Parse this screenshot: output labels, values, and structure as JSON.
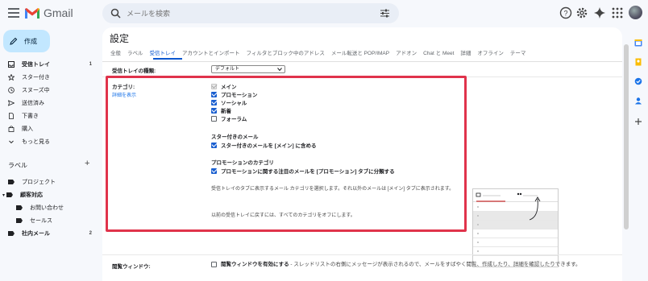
{
  "app": {
    "name": "Gmail",
    "search_placeholder": "メールを検索"
  },
  "colors": {
    "accent": "#0b57d0",
    "highlight_border": "#e0334b",
    "compose_bg": "#c2e7ff"
  },
  "sidebar": {
    "compose_label": "作成",
    "items": [
      {
        "label": "受信トレイ",
        "count": "1",
        "icon": "inbox-icon",
        "bold": true
      },
      {
        "label": "スター付き",
        "icon": "star-icon"
      },
      {
        "label": "スヌーズ中",
        "icon": "clock-icon"
      },
      {
        "label": "送信済み",
        "icon": "send-icon"
      },
      {
        "label": "下書き",
        "icon": "draft-icon"
      },
      {
        "label": "購入",
        "icon": "purchase-icon"
      },
      {
        "label": "もっと見る",
        "icon": "chevron-down-icon"
      }
    ],
    "labels_heading": "ラベル",
    "labels": [
      {
        "label": "プロジェクト"
      },
      {
        "label": "顧客対応",
        "bold": true
      },
      {
        "label": "お問い合わせ"
      },
      {
        "label": "セールス"
      },
      {
        "label": "社内メール",
        "count": "2",
        "bold": true
      }
    ]
  },
  "settings": {
    "title": "設定",
    "tabs": [
      "全般",
      "ラベル",
      "受信トレイ",
      "アカウントとインポート",
      "フィルタとブロック中のアドレス",
      "メール転送と POP/IMAP",
      "アドオン",
      "Chat と Meet",
      "詳細",
      "オフライン",
      "テーマ"
    ],
    "active_tab_index": 2,
    "inbox_type_label": "受信トレイの種類:",
    "inbox_type_value": "デフォルト",
    "categories_label": "カテゴリ:",
    "details_link": "詳細を表示",
    "categories": [
      {
        "label": "メイン",
        "checked": true,
        "disabled": true
      },
      {
        "label": "プロモーション",
        "checked": true
      },
      {
        "label": "ソーシャル",
        "checked": true
      },
      {
        "label": "新着",
        "checked": true
      },
      {
        "label": "フォーラム",
        "checked": false
      }
    ],
    "starred_heading": "スター付きのメール",
    "starred_option": "スター付きのメールを [メイン] に含める",
    "promo_heading": "プロモーションのカテゴリ",
    "promo_option": "プロモーションに関する注目のメールを [プロモーション] タブに分類する",
    "description_1": "受信トレイのタブに表示するメール カテゴリを選択します。それ以外のメールは [メイン] タブに表示されます。",
    "description_2": "以前の受信トレイに戻すには、すべてのカテゴリをオフにします。",
    "reading_pane_label": "閲覧ウィンドウ:",
    "reading_pane_option": "閲覧ウィンドウを有効にする",
    "reading_pane_desc": " - スレッドリストの右側にメッセージが表示されるので、メールをすばやく閲覧、作成したり、詳細を確認したりできます。"
  }
}
